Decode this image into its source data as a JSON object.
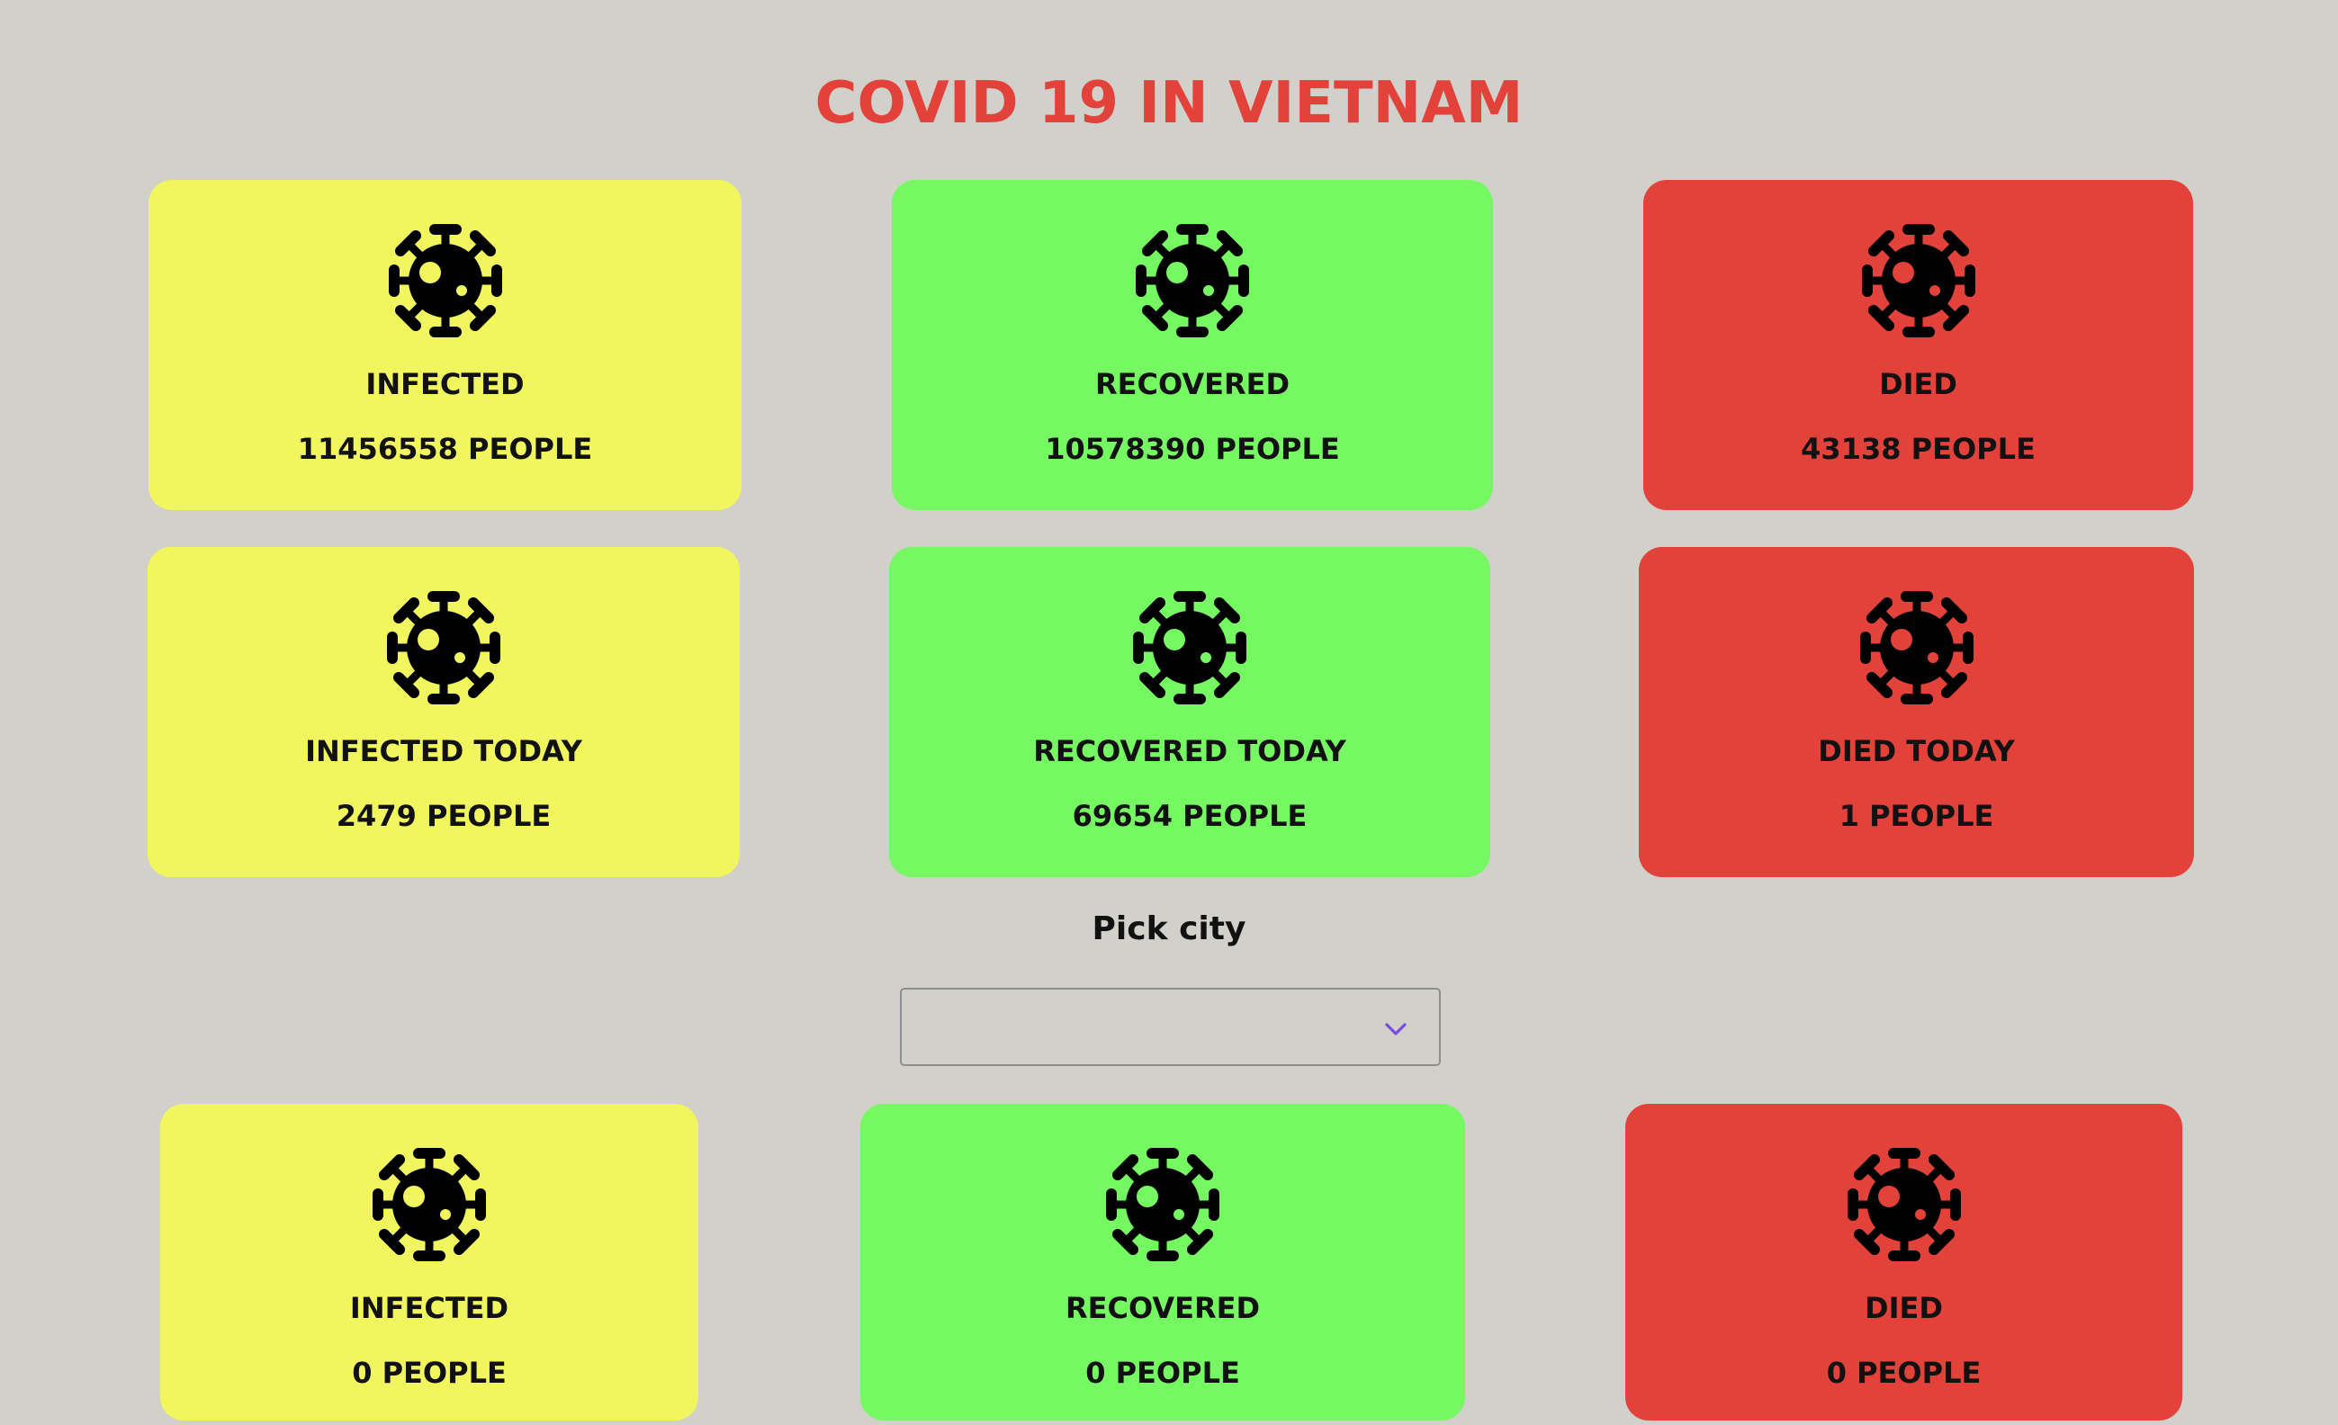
{
  "header": {
    "title": "COVID 19 IN VIETNAM"
  },
  "icon": "virus-icon",
  "colors": {
    "background": "#d1d0ca",
    "title": "#e2423a",
    "infected": "#f2f65e",
    "recovered": "#76f863",
    "died": "#e3423a",
    "chevron": "#7a4ce0"
  },
  "summary": [
    {
      "label": "INFECTED",
      "value": "11456558 PEOPLE"
    },
    {
      "label": "RECOVERED",
      "value": "10578390 PEOPLE"
    },
    {
      "label": "DIED",
      "value": "43138 PEOPLE"
    }
  ],
  "today": [
    {
      "label": "INFECTED TODAY",
      "value": "2479 PEOPLE"
    },
    {
      "label": "RECOVERED TODAY",
      "value": "69654 PEOPLE"
    },
    {
      "label": "DIED TODAY",
      "value": "1 PEOPLE"
    }
  ],
  "city_picker": {
    "label": "Pick city",
    "selected": ""
  },
  "city": [
    {
      "label": "INFECTED",
      "value": "0 PEOPLE"
    },
    {
      "label": "RECOVERED",
      "value": "0 PEOPLE"
    },
    {
      "label": "DIED",
      "value": "0 PEOPLE"
    }
  ]
}
